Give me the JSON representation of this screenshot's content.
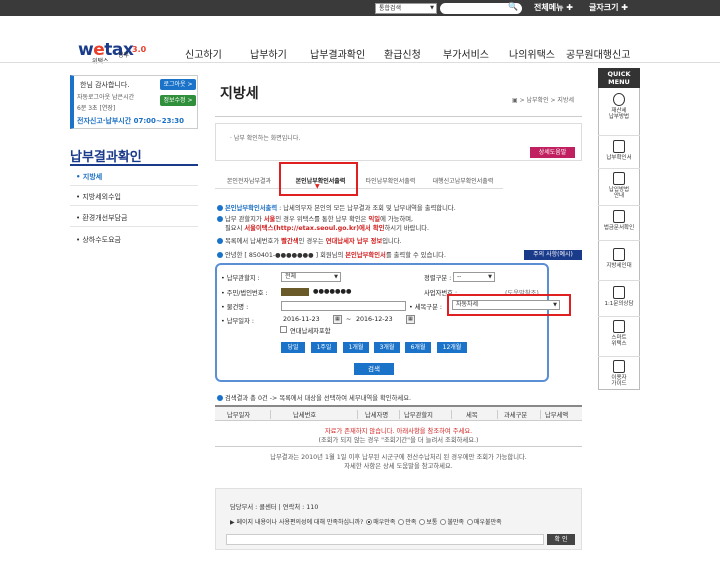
{
  "topbar": {
    "search_select": "통합검색",
    "all_menu": "전체메뉴 ✚",
    "font_size": "글자크기 ✚"
  },
  "logo": {
    "main_pre": "w",
    "main_e": "e",
    "main_post": "tax",
    "sub": "위택스",
    "version": "3.0",
    "small": "정부"
  },
  "nav": [
    "신고하기",
    "납부하기",
    "납부결과확인",
    "환급신청",
    "부가서비스",
    "나의위택스",
    "공무원대행신고"
  ],
  "login": {
    "line1": "한님 감사합니다.",
    "line2": "자동로그아웃 남은시간",
    "line3": "6분 3초 [연장]",
    "hours": "전자신고·납부시간 07:00~23:30",
    "logout": "로그아웃 >",
    "info_edit": "정보수정 >"
  },
  "left": {
    "title": "납부결과확인",
    "items": [
      "• 지방세",
      "• 지방세외수입",
      "• 환경개선부담금",
      "• 상하수도요금"
    ]
  },
  "page": {
    "title": "지방세",
    "breadcrumb": "▣ > 납부확인 > 지방세",
    "info_msg": "· 납부 확인하는 화면입니다.",
    "help_btn": "상세도움말"
  },
  "tabs": [
    "본인전자납부결과",
    "본인납부확인서출력",
    "타인납부확인서출력",
    "대행신고납부확인서출력"
  ],
  "bullets": {
    "b1_a": "본인납부확인서출력",
    "b1_b": " : 납세의무자 본인의 모든 납부결과 조회 및 납부내역을 출력합니다.",
    "b2_a": "납부 관할지가 ",
    "b2_b": "서울",
    "b2_c": "인 경우 위택스를 통한 납부 확인은 ",
    "b2_d": "익일",
    "b2_e": "에 가능하며,",
    "b2_line2_a": "필요시 ",
    "b2_line2_b": "서울이택스(http://etax.seoul.go.kr)에서 확인",
    "b2_line2_c": "하시기 바랍니다.",
    "b3_a": "목록에서 납세번호가 ",
    "b3_b": "빨간색",
    "b3_c": "인 경우는 ",
    "b3_d": "연대납세자 납부 정보",
    "b3_e": "입니다.",
    "b4_a": "안녕한 [ 850401-●●●●●●● ] 회원님의 ",
    "b4_b": "본인납부확인서",
    "b4_c": "를 출력할 수 있습니다.",
    "notice": "주의 사항(예시)"
  },
  "form": {
    "label_jurisdiction": "• 납부관할지 :",
    "jurisdiction_value": "전체",
    "label_sort": "정렬구분 :",
    "sort_value": "--",
    "label_id": "• 주민/법인번호 :",
    "id_value": "●●●●●●●",
    "label_bizno": "사업자번호 :",
    "bizno_hint": "(도움말참조)",
    "label_item": "• 물건명 :",
    "label_taxtype": "• 세목구분 :",
    "taxtype_value": "자동차세",
    "label_paydate": "• 납부일자 :",
    "date_from": "2016-11-23",
    "date_to": "2016-12-23",
    "tilde": "~",
    "joint_label": "연대납세자포함",
    "periods": [
      "당일",
      "1주일",
      "1개월",
      "3개월",
      "6개월",
      "12개월"
    ],
    "search_btn": "검색"
  },
  "results": {
    "count_msg": "검색결과 총 0건 -> 목록에서 대상을 선택하여 세부내역을 확인하세요.",
    "headers": [
      "납부일자",
      "납세번호",
      "납세자명",
      "납부관할지",
      "세목",
      "과세구분",
      "납부세액"
    ],
    "empty1": "자료가 존재하지 않습니다. 아래사항을 참조하여 주세요.",
    "empty2": "(조회가 되지 않는 경우 \"조회기간\"을 더 늘려서 조회하세요.)",
    "note1": "납부결과는 2010년 1월 1일 이후 납부된 시군구에 전산수납처리 된 경우에만 조회가 가능합니다.",
    "note2": "자세한 사항은 상세 도움말을 참고하세요."
  },
  "survey": {
    "dept": "담당부서 : 콜센터 | 연락처 : 110",
    "question": "▶ 페이지 내용이나 사용편의성에 대해 만족하십니까?",
    "options": [
      "매우만족",
      "만족",
      "보통",
      "불만족",
      "매우불만족"
    ],
    "ok": "확 인"
  },
  "quick": {
    "head1": "QUICK",
    "head2": "MENU",
    "items": [
      "재산세\n납부방법",
      "납부확인서",
      "납입방법\n안내",
      "법금문서확인",
      "지방세인대",
      "1:1문의상담",
      "스마트\n위택스",
      "이용자\n가이드"
    ]
  }
}
